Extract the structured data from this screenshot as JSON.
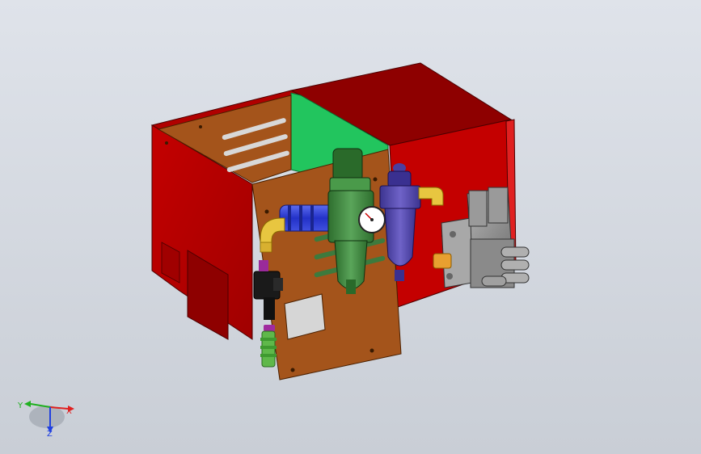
{
  "viewport": {
    "background_top": "#dfe3ea",
    "background_bottom": "#c9ced6"
  },
  "model": {
    "colors": {
      "enclosure": "#c00000",
      "enclosure_dark": "#8e0000",
      "panel": "#a4541b",
      "panel_dark": "#7c3c12",
      "green_plate": "#22c55e",
      "filter_green": "#3f8a3f",
      "lubricator_blue": "#5a4fb0",
      "fitting_blue": "#2f3fd8",
      "fitting_brass": "#e8c640",
      "valve_grey": "#9a9a9a",
      "connector_green": "#5fb84a"
    }
  },
  "triad": {
    "x_label": "X",
    "y_label": "Y",
    "z_label": "Z",
    "x_color": "#e02020",
    "y_color": "#20b020",
    "z_color": "#2040e0"
  }
}
